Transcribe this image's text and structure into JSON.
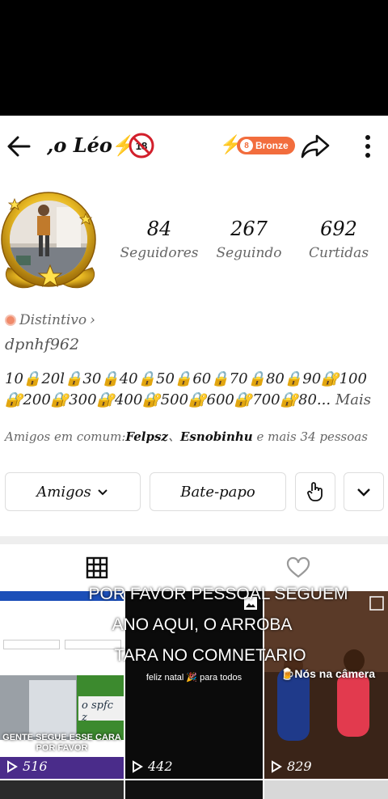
{
  "header": {
    "username": ",o Léo",
    "bolt": "⚡",
    "badge_18": "18",
    "bolt2": "⚡",
    "rank_label": "Bronze"
  },
  "stats": [
    {
      "value": "84",
      "label": "Seguidores"
    },
    {
      "value": "267",
      "label": "Seguindo"
    },
    {
      "value": "692",
      "label": "Curtidas"
    }
  ],
  "profile": {
    "distintivo": "Distintivo",
    "distintivo_chev": "›",
    "handle": "dpnhf962",
    "bio_line1": "10🔒20l🔒30🔒40🔒50🔒60🔒70🔒80🔒90🔐100",
    "bio_line2": "🔐200🔐300🔐400🔐500🔐600🔐700🔐80...",
    "bio_more": "Mais",
    "mutual_prefix": "Amigos em comum:",
    "mutual_name1": "Felpsz",
    "mutual_sep": "、",
    "mutual_name2": "Esnobinhu",
    "mutual_suffix": "e mais 34 pessoas"
  },
  "actions": {
    "friends": "Amigos",
    "chat": "Bate-papo"
  },
  "overlay": {
    "line1": "POR FAVOR PESSOAL SEGUEM",
    "line2": "ANO AQUI, O ARROBA",
    "line3": "TARA NO COMNETARIO"
  },
  "videos": [
    {
      "views": "516",
      "caption": "GENTE SEGUE ESSE CARA POR FAVOR",
      "sticker": "o spfc z"
    },
    {
      "views": "442",
      "caption": "feliz natal 🎉 para todos"
    },
    {
      "views": "829",
      "caption": "🍺Nós na câmera"
    }
  ],
  "colors": {
    "accent_orange": "#f26d3d",
    "bolt": "#f5b400",
    "muted_text": "#666666"
  }
}
